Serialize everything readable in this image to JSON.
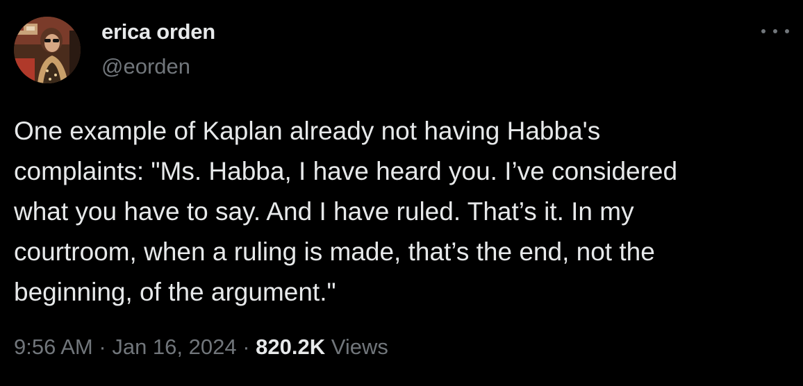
{
  "author": {
    "name": "erica orden",
    "handle": "@eorden"
  },
  "tweet": {
    "lines": [
      "One example of Kaplan already not having Habba's",
      "complaints: \"Ms. Habba, I have heard you. I’ve considered",
      "what you have to say. And I have ruled. That’s it. In my",
      "courtroom, when a ruling is made, that’s the end, not the",
      "beginning, of the argument.\""
    ]
  },
  "meta": {
    "time": "9:56 AM",
    "separator": "·",
    "date": "Jan 16, 2024",
    "views_count": "820.2K",
    "views_label": "Views"
  },
  "icons": {
    "more": "more-options-icon"
  },
  "colors": {
    "background": "#000000",
    "primary_text": "#e7e9ea",
    "secondary_text": "#71767b"
  }
}
